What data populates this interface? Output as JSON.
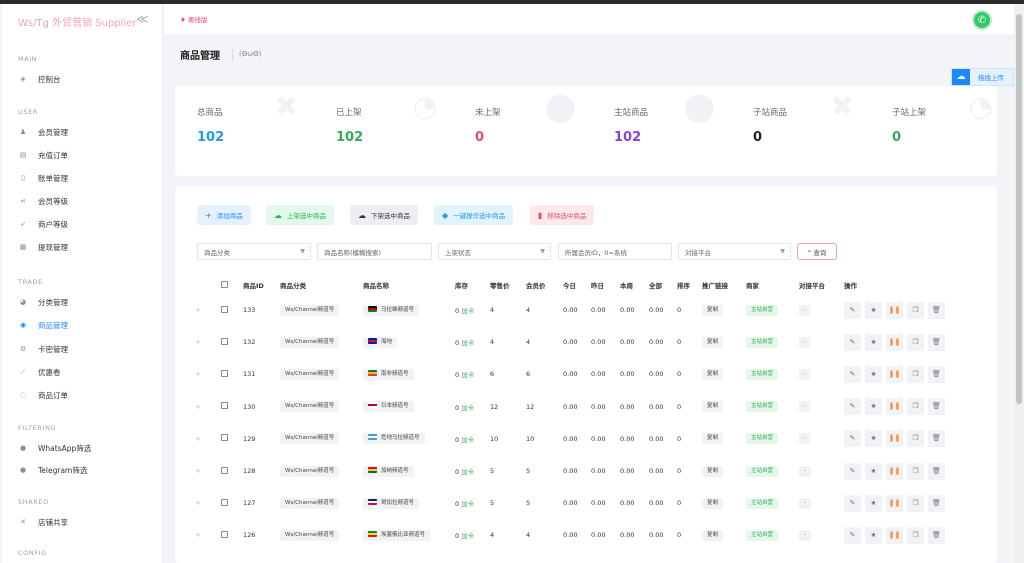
{
  "sidebar": {
    "brand": "Ws/Tg 外贸营销 Supplier",
    "collapse": "≪",
    "sections": {
      "main": "MAIN",
      "user": "USER",
      "trade": "TRADE",
      "filtering": "FILTERING",
      "shared": "SHARED",
      "config": "CONFIG"
    },
    "items": [
      {
        "label": "控制台",
        "icon": "eye-icon"
      },
      {
        "label": "会员管理",
        "icon": "user-icon"
      },
      {
        "label": "充值订单",
        "icon": "card-icon"
      },
      {
        "label": "账单管理",
        "icon": "bill-icon"
      },
      {
        "label": "会员等级",
        "icon": "share-icon"
      },
      {
        "label": "商户等级",
        "icon": "rocket-icon"
      },
      {
        "label": "提现管理",
        "icon": "list-icon"
      },
      {
        "label": "分类管理",
        "icon": "pie-icon"
      },
      {
        "label": "商品管理",
        "icon": "circle-icon"
      },
      {
        "label": "卡密管理",
        "icon": "gear-icon"
      },
      {
        "label": "优惠卷",
        "icon": "ticket-icon"
      },
      {
        "label": "商品订单",
        "icon": "order-icon"
      },
      {
        "label": "WhatsApp筛选",
        "icon": "dot-icon"
      },
      {
        "label": "Telegram筛选",
        "icon": "dot-icon"
      },
      {
        "label": "店铺共享",
        "icon": "cross-icon"
      }
    ]
  },
  "header": {
    "status": "离线版",
    "avatar_icon": "whatsapp-icon"
  },
  "page": {
    "title": "商品管理",
    "subtitle": "(ΘωΘ)",
    "float_button": "拖拽上传"
  },
  "stats": [
    {
      "label": "总商品",
      "value": "102",
      "color": "#1e9be9"
    },
    {
      "label": "已上架",
      "value": "102",
      "color": "#2eae5a"
    },
    {
      "label": "未上架",
      "value": "0",
      "color": "#e94b6b"
    },
    {
      "label": "主站商品",
      "value": "102",
      "color": "#8b3fd9"
    },
    {
      "label": "子站商品",
      "value": "0",
      "color": "#222222"
    },
    {
      "label": "子站上架",
      "value": "0",
      "color": "#2eae5a"
    }
  ],
  "toolbar": {
    "add": "添加商品",
    "shelve": "上架选中商品",
    "unshelve": "下架选中商品",
    "batch": "一键操作选中商品",
    "remove": "移除选中商品"
  },
  "filters": {
    "category": "商品分类",
    "name_placeholder": "商品名称(模糊搜索)",
    "status": "上架状态",
    "member": "所属会员ID，0=系统",
    "platform": "对接平台",
    "query": "查询"
  },
  "table": {
    "headers": [
      "商品ID",
      "商品分类",
      "商品名称",
      "库存",
      "零售价",
      "会员价",
      "今日",
      "昨日",
      "本周",
      "全部",
      "排序",
      "推广链接",
      "商家",
      "对接平台",
      "操作"
    ],
    "rows": [
      {
        "id": "133",
        "category": "Ws/Channel频道号",
        "name": "马拉维频道号",
        "stock": "0",
        "stock_label": "加卡",
        "retail": "4",
        "member": "4",
        "today": "0.00",
        "yesterday": "0.00",
        "week": "0.00",
        "all": "0.00",
        "sort": "0",
        "link": "复制",
        "merchant": "主站自营",
        "platform": "-"
      },
      {
        "id": "132",
        "category": "Ws/Channel频道号",
        "name": "海地",
        "stock": "0",
        "stock_label": "加卡",
        "retail": "4",
        "member": "4",
        "today": "0.00",
        "yesterday": "0.00",
        "week": "0.00",
        "all": "0.00",
        "sort": "0",
        "link": "复制",
        "merchant": "主站自营",
        "platform": "-"
      },
      {
        "id": "131",
        "category": "Ws/Channel频道号",
        "name": "南非频道号",
        "stock": "0",
        "stock_label": "加卡",
        "retail": "6",
        "member": "6",
        "today": "0.00",
        "yesterday": "0.00",
        "week": "0.00",
        "all": "0.00",
        "sort": "0",
        "link": "复制",
        "merchant": "主站自营",
        "platform": "-"
      },
      {
        "id": "130",
        "category": "Ws/Channel频道号",
        "name": "日本频道号",
        "stock": "0",
        "stock_label": "加卡",
        "retail": "12",
        "member": "12",
        "today": "0.00",
        "yesterday": "0.00",
        "week": "0.00",
        "all": "0.00",
        "sort": "0",
        "link": "复制",
        "merchant": "主站自营",
        "platform": "-"
      },
      {
        "id": "129",
        "category": "Ws/Channel频道号",
        "name": "危地马拉频道号",
        "stock": "0",
        "stock_label": "加卡",
        "retail": "10",
        "member": "10",
        "today": "0.00",
        "yesterday": "0.00",
        "week": "0.00",
        "all": "0.00",
        "sort": "0",
        "link": "复制",
        "merchant": "主站自营",
        "platform": "-"
      },
      {
        "id": "128",
        "category": "Ws/Channel频道号",
        "name": "加纳频道号",
        "stock": "0",
        "stock_label": "加卡",
        "retail": "5",
        "member": "5",
        "today": "0.00",
        "yesterday": "0.00",
        "week": "0.00",
        "all": "0.00",
        "sort": "0",
        "link": "复制",
        "merchant": "主站自营",
        "platform": "-"
      },
      {
        "id": "127",
        "category": "Ws/Channel频道号",
        "name": "哥加拉频道号",
        "stock": "0",
        "stock_label": "加卡",
        "retail": "5",
        "member": "5",
        "today": "0.00",
        "yesterday": "0.00",
        "week": "0.00",
        "all": "0.00",
        "sort": "0",
        "link": "复制",
        "merchant": "主站自营",
        "platform": "-"
      },
      {
        "id": "126",
        "category": "Ws/Channel频道号",
        "name": "埃塞俄比亚频道号",
        "stock": "0",
        "stock_label": "加卡",
        "retail": "4",
        "member": "4",
        "today": "0.00",
        "yesterday": "0.00",
        "week": "0.00",
        "all": "0.00",
        "sort": "0",
        "link": "复制",
        "merchant": "主站自营",
        "platform": "-"
      }
    ]
  },
  "colors": {
    "primary": "#1e88ff",
    "green": "#2eae5a",
    "red": "#e94b6b",
    "purple": "#8b3fd9"
  }
}
